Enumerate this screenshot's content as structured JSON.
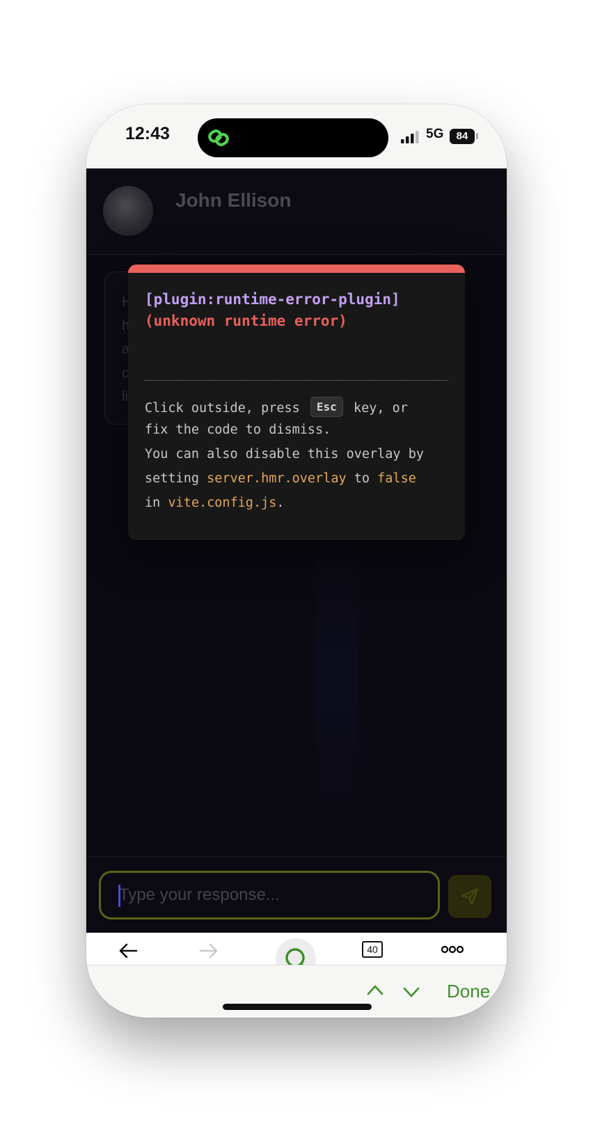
{
  "status_bar": {
    "time": "12:43",
    "network": "5G",
    "battery": "84"
  },
  "chat": {
    "contact_name": "John Ellison",
    "message_preview_initials": [
      "H",
      "h",
      "a",
      "c",
      "li"
    ],
    "input_placeholder": "Type your response..."
  },
  "error_overlay": {
    "title": "[plugin:runtime-error-plugin]",
    "message": "(unknown runtime error)",
    "tip_line1_before": "Click outside, press",
    "tip_key": "Esc",
    "tip_line1_after": "key, or",
    "tip_line2": "fix the code to dismiss.",
    "tip_line3": "You can also disable this overlay by",
    "tip_line4_before": "setting",
    "tip_line4_code": "server.hmr.overlay",
    "tip_line4_middle": "to",
    "tip_line4_value": "false",
    "tip_line5_before": "in",
    "tip_line5_code": "vite.config.js",
    "tip_line5_after": "."
  },
  "browser_toolbar": {
    "tab_count": "40"
  },
  "find_bar": {
    "done_label": "Done"
  },
  "colors": {
    "accent_green": "#3e8e2a",
    "error_red": "#e8615b",
    "title_purple": "#c3a0f2",
    "code_yellow": "#e1a858"
  }
}
